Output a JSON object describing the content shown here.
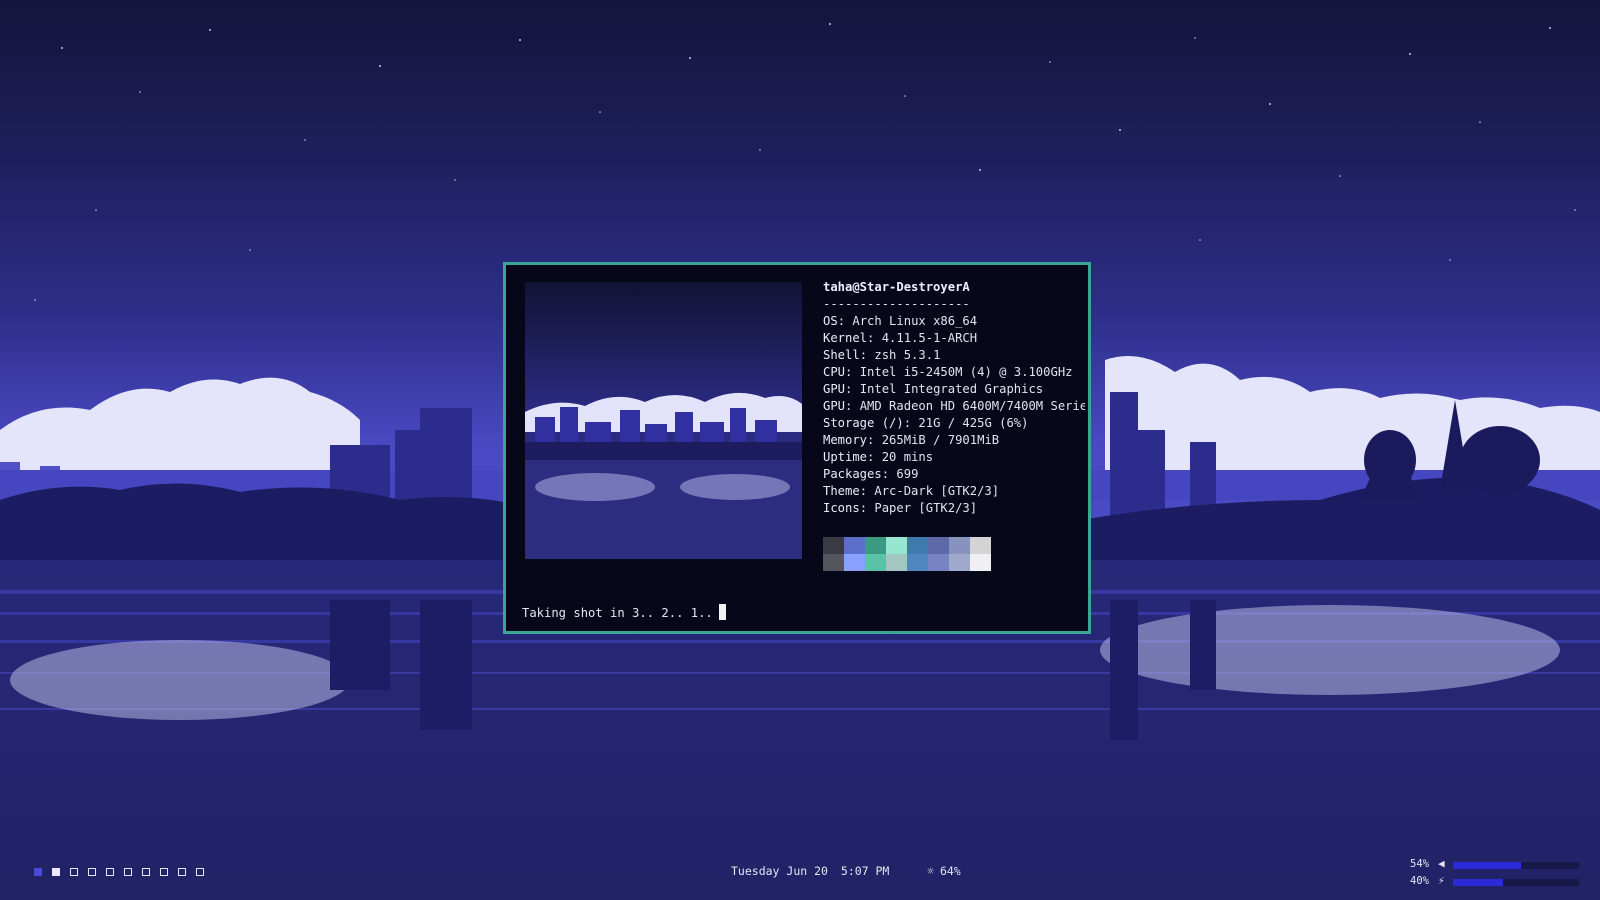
{
  "terminal": {
    "header": "taha@Star-DestroyerA",
    "separator": "--------------------",
    "info": [
      {
        "key": "OS",
        "value": "Arch Linux x86_64"
      },
      {
        "key": "Kernel",
        "value": "4.11.5-1-ARCH"
      },
      {
        "key": "Shell",
        "value": "zsh 5.3.1"
      },
      {
        "key": "CPU",
        "value": "Intel i5-2450M (4) @ 3.100GHz"
      },
      {
        "key": "GPU",
        "value": "Intel Integrated Graphics"
      },
      {
        "key": "GPU",
        "value": "AMD Radeon HD 6400M/7400M Serie"
      },
      {
        "key": "Storage (/)",
        "value": "21G / 425G (6%)"
      },
      {
        "key": "Memory",
        "value": "265MiB / 7901MiB"
      },
      {
        "key": "Uptime",
        "value": "20 mins"
      },
      {
        "key": "Packages",
        "value": "699"
      },
      {
        "key": "Theme",
        "value": "Arc-Dark [GTK2/3]"
      },
      {
        "key": "Icons",
        "value": "Paper [GTK2/3]"
      }
    ],
    "palette_dark": [
      "#3a3a44",
      "#5b6ec8",
      "#3b9a84",
      "#96e6d2",
      "#3f7aac",
      "#5d68a6",
      "#8892be",
      "#d4d4d4"
    ],
    "palette_light": [
      "#55555e",
      "#8aa0ff",
      "#5ac2a6",
      "#a2c6c0",
      "#4f86c0",
      "#7784c4",
      "#a0a8cc",
      "#f0f0f4"
    ],
    "prompt_text": "Taking shot in 3.. 2.. 1..",
    "border_color": "#3aa597"
  },
  "bar": {
    "workspaces": [
      "active",
      "occupied",
      "empty",
      "empty",
      "empty",
      "empty",
      "empty",
      "empty",
      "empty",
      "empty"
    ],
    "clock": {
      "day": "Tuesday",
      "date": "Jun 20",
      "time": "5:07 PM"
    },
    "brightness": {
      "icon": "brightness-icon",
      "label": "64%"
    },
    "volume": {
      "label": "54%",
      "icon": "volume-icon",
      "level": 0.54
    },
    "battery": {
      "label": "40%",
      "icon": "battery-charging-icon",
      "level": 0.4
    }
  }
}
